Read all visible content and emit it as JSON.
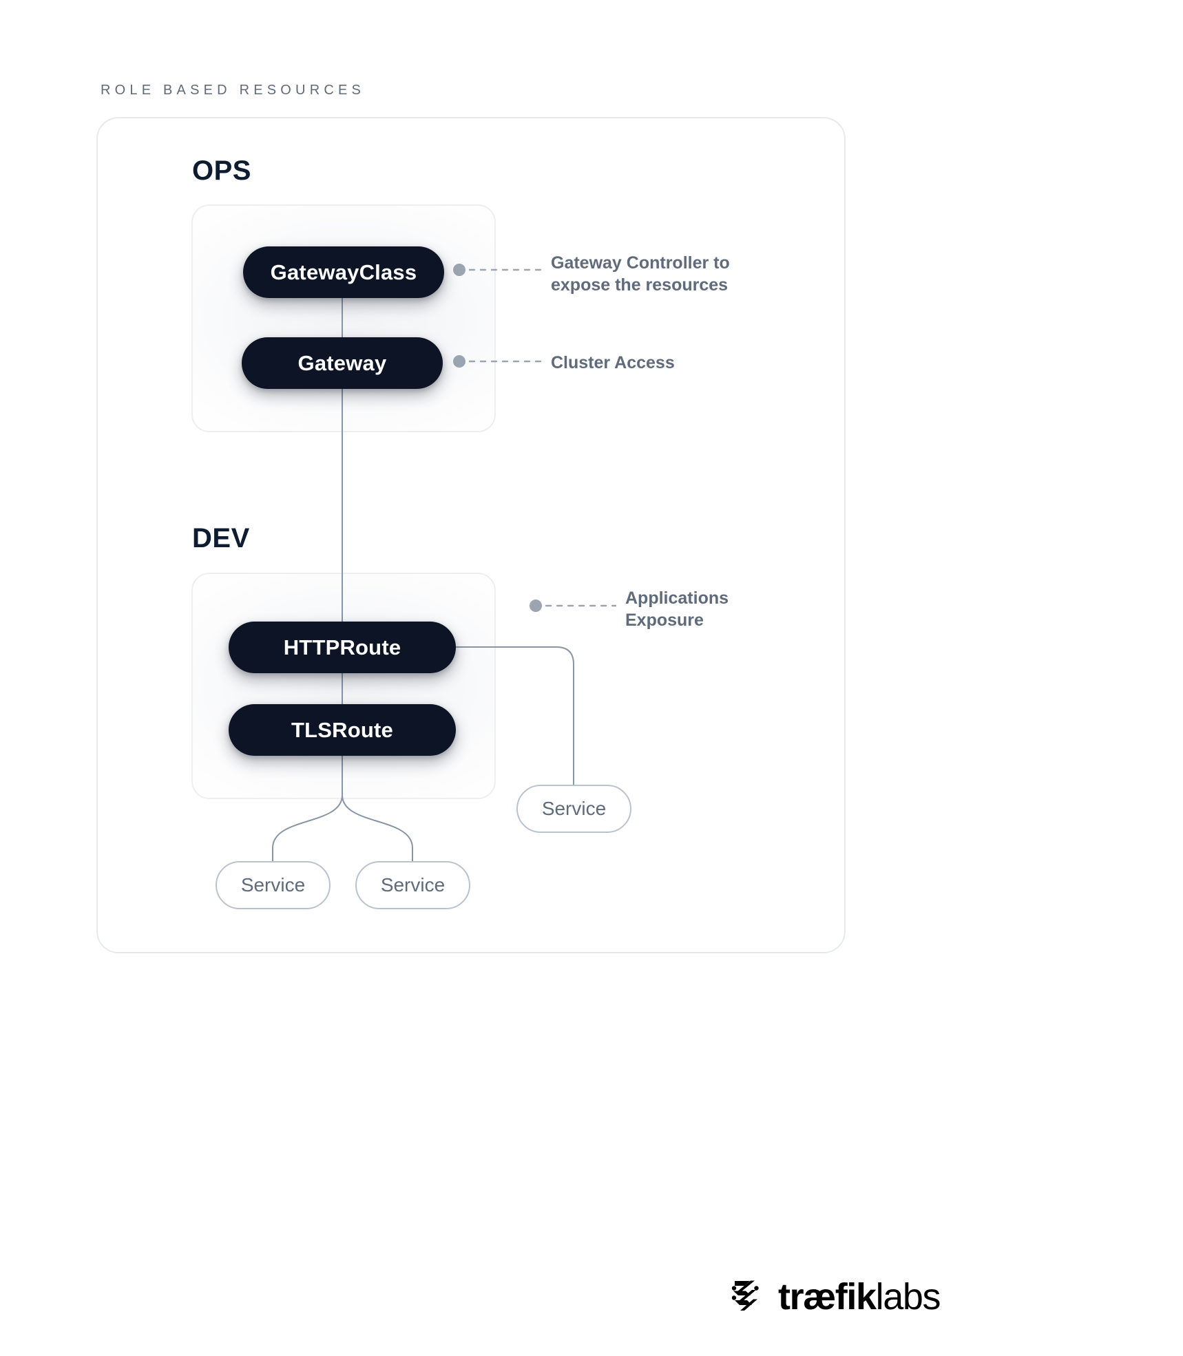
{
  "diagram": {
    "eyebrow": "ROLE BASED RESOURCES",
    "sections": [
      {
        "id": "ops",
        "heading": "OPS"
      },
      {
        "id": "dev",
        "heading": "DEV"
      }
    ],
    "nodes": {
      "gatewayclass": "GatewayClass",
      "gateway": "Gateway",
      "httproute": "HTTPRoute",
      "tlsroute": "TLSRoute",
      "service_right": "Service",
      "service_left": "Service",
      "service_middle": "Service"
    },
    "annotations": {
      "gateway_controller": "Gateway Controller to\nexpose the resources",
      "cluster_access": "Cluster Access",
      "applications_exposure": "Applications\nExposure"
    },
    "colors": {
      "node_dark": "#0d1426",
      "node_dark_text": "#ffffff",
      "service_border": "#b9c3ce",
      "service_text": "#5e6b7a",
      "annotation_text": "#5f6b7a",
      "heading_text": "#0d1c30",
      "frame_border": "#e7e9ec",
      "connector": "#8895a4",
      "leader": "#9aa5b1",
      "background": "#ffffff"
    }
  },
  "brand": {
    "logo_mark": "traefik-chevron-mark",
    "name_bold": "træfik",
    "name_light": "labs"
  }
}
